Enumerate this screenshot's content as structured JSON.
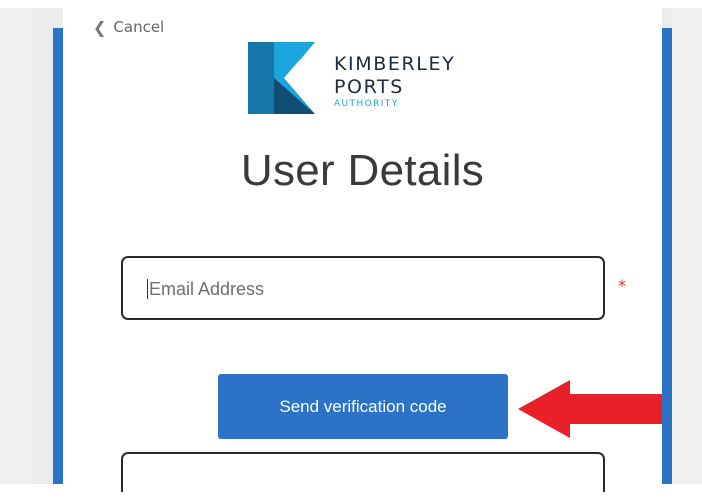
{
  "nav": {
    "cancel_label": "Cancel"
  },
  "brand": {
    "name_line1": "KIMBERLEY",
    "name_line2": "PORTS",
    "name_line3": "AUTHORITY",
    "colors": {
      "light_blue": "#1aa6dc",
      "mid_blue": "#1576a8",
      "dark_blue": "#0f4d73"
    }
  },
  "page": {
    "title": "User Details"
  },
  "form": {
    "email": {
      "placeholder": "Email Address",
      "value": "",
      "required_marker": "*"
    },
    "send_button_label": "Send verification code"
  },
  "colors": {
    "accent": "#2c72c6",
    "required": "#d9302c",
    "annotation_arrow": "#e8202a"
  },
  "annotation": {
    "icon": "red-arrow-icon",
    "points_to": "send-verification-button"
  }
}
